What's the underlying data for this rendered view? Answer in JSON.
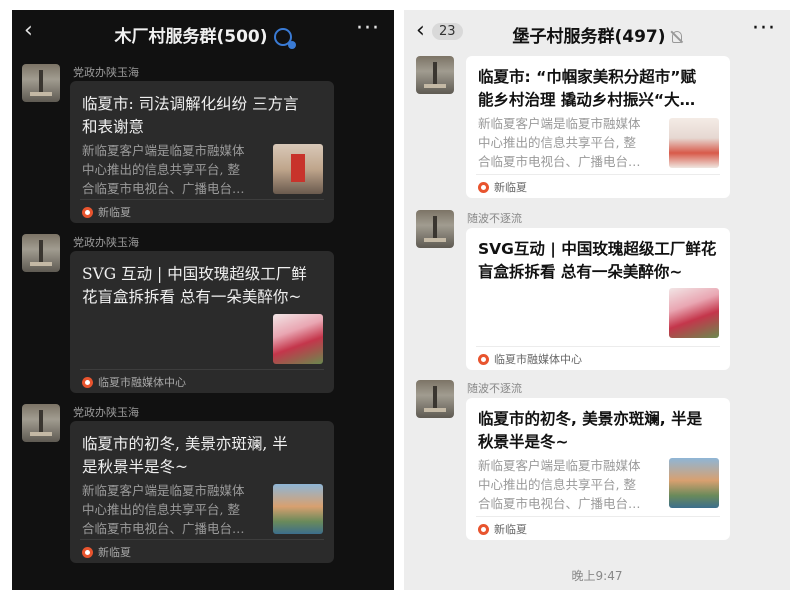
{
  "left": {
    "back_icon": "‹",
    "title": "木厂村服务群(500)",
    "more_icon": "···",
    "messages": [
      {
        "sender": "党政办陕玉海",
        "title_lines": [
          "临夏市: 司法调解化纠纷 三方言",
          "和表谢意"
        ],
        "desc_lines": [
          "新临夏客户端是临夏市融媒体",
          "中心推出的信息共享平台, 整",
          "合临夏市电视台、广播电台…"
        ],
        "source": "新临夏"
      },
      {
        "sender": "党政办陕玉海",
        "title_lines": [
          "SVG 互动 | 中国玫瑰超级工厂鲜",
          "花盲盒拆拆看 总有一朵美醉你~"
        ],
        "desc_lines": [],
        "source": "临夏市融媒体中心"
      },
      {
        "sender": "党政办陕玉海",
        "title_lines": [
          "临夏市的初冬, 美景亦斑斓, 半",
          "是秋景半是冬~"
        ],
        "desc_lines": [
          "新临夏客户端是临夏市融媒体",
          "中心推出的信息共享平台, 整",
          "合临夏市电视台、广播电台…"
        ],
        "source": "新临夏"
      }
    ]
  },
  "right": {
    "back_icon": "‹",
    "unread_count": "23",
    "title": "堡子村服务群(497)",
    "more_icon": "···",
    "messages": [
      {
        "sender": "",
        "title_lines": [
          "临夏市: “巾帼家美积分超市”赋",
          "能乡村治理 撬动乡村振兴“大…"
        ],
        "desc_lines": [
          "新临夏客户端是临夏市融媒体",
          "中心推出的信息共享平台, 整",
          "合临夏市电视台、广播电台…"
        ],
        "source": "新临夏"
      },
      {
        "sender": "随波不逐流",
        "title_lines": [
          "SVG互动 | 中国玫瑰超级工厂鲜花",
          "盲盒拆拆看 总有一朵美醉你~"
        ],
        "desc_lines": [],
        "source": "临夏市融媒体中心"
      },
      {
        "sender": "随波不逐流",
        "title_lines": [
          "临夏市的初冬, 美景亦斑斓, 半是",
          "秋景半是冬~"
        ],
        "desc_lines": [
          "新临夏客户端是临夏市融媒体",
          "中心推出的信息共享平台, 整",
          "合临夏市电视台、广播电台…"
        ],
        "source": "新临夏"
      }
    ],
    "timestamp": "晚上9:47"
  },
  "colors": {
    "left_bg": "#111111",
    "left_card": "#2b2b2b",
    "right_bg": "#ededed",
    "right_card": "#ffffff",
    "source_icon": "#e8542e",
    "verified_badge": "#3a7bd5"
  },
  "icons": [
    "back-icon",
    "more-icon",
    "verified-badge-icon",
    "mute-icon",
    "source-logo-icon"
  ]
}
